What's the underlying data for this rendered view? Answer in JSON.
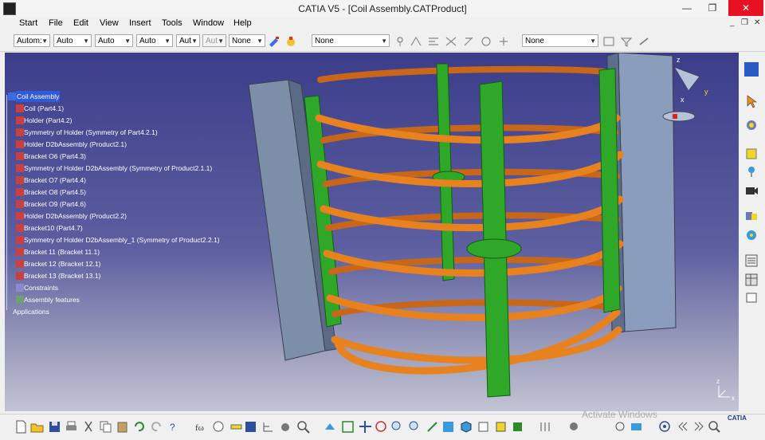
{
  "window": {
    "title": "CATIA V5 - [Coil Assembly.CATProduct]",
    "min": "—",
    "max": "❐",
    "close": "✕"
  },
  "menu": {
    "items": [
      "Start",
      "File",
      "Edit",
      "View",
      "Insert",
      "Tools",
      "Window",
      "Help"
    ]
  },
  "mdi": {
    "min": "_",
    "max": "❐",
    "close": "✕"
  },
  "toolbar": {
    "combos": [
      "Autom:",
      "Auto",
      "Auto",
      "Auto",
      "Aut",
      "Aut",
      "None"
    ],
    "filter1": "None",
    "filter2": "None"
  },
  "tree": {
    "root": "Coil Assembly",
    "items": [
      "Coil (Part4.1)",
      "Holder (Part4.2)",
      "Symmetry of Holder (Symmetry of Part4.2.1)",
      "Holder D2bAssembly (Product2.1)",
      "Bracket O6 (Part4.3)",
      "Symmetry of Holder D2bAssembly (Symmetry of Product2.1.1)",
      "Bracket O7 (Part4.4)",
      "Bracket O8 (Part4.5)",
      "Bracket O9 (Part4.6)",
      "Holder D2bAssembly (Product2.2)",
      "Bracket10 (Part4.7)",
      "Symmetry of Holder D2bAssembly_1 (Symmetry of Product2.2.1)",
      "Bracket 11 (Bracket 11.1)",
      "Bracket 12 (Bracket 12.1)",
      "Bracket 13 (Bracket 13.1)",
      "Constraints",
      "Assembly features"
    ],
    "applications": "Applications"
  },
  "compass": {
    "x": "x",
    "y": "y",
    "z": "z"
  },
  "axis": {
    "x": "x",
    "y": "y",
    "z": "z"
  },
  "watermark": "Activate Windows",
  "logo": "CATIA",
  "colors": {
    "viewport_top": "#3c3d8a",
    "coil": "#e8821e",
    "bracket": "#2fa82a",
    "holder": "#8aa0bf",
    "tree_select": "#2f5ad8"
  }
}
